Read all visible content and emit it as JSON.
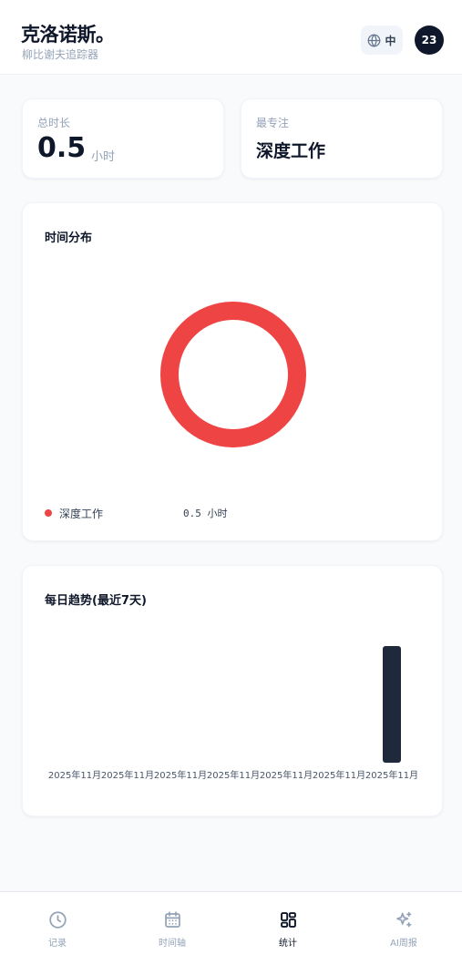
{
  "header": {
    "title": "克洛诺斯。",
    "subtitle": "柳比谢夫追踪器",
    "lang_label": "中",
    "avatar_text": "23"
  },
  "stats": {
    "total_label": "总时长",
    "total_value": "0.5",
    "total_unit": "小时",
    "focus_label": "最专注",
    "focus_value": "深度工作"
  },
  "distribution": {
    "title": "时间分布",
    "legend": [
      {
        "name": "深度工作",
        "value": "0.5 小时",
        "color": "#ef4444"
      }
    ]
  },
  "trend": {
    "title": "每日趋势(最近7天)"
  },
  "nav": {
    "items": [
      {
        "label": "记录",
        "icon": "clock-icon"
      },
      {
        "label": "时间轴",
        "icon": "calendar-icon"
      },
      {
        "label": "统计",
        "icon": "grid-icon"
      },
      {
        "label": "AI周报",
        "icon": "sparkles-icon"
      }
    ],
    "active_index": 2
  },
  "chart_data": [
    {
      "type": "pie",
      "title": "时间分布",
      "labels": [
        "深度工作"
      ],
      "values": [
        0.5
      ],
      "colors": [
        "#ef4444"
      ],
      "unit": "小时",
      "donut": true
    },
    {
      "type": "bar",
      "title": "每日趋势(最近7天)",
      "categories": [
        "2025年11月",
        "2025年11月",
        "2025年11月",
        "2025年11月",
        "2025年11月",
        "2025年11月",
        "2025年11月"
      ],
      "values": [
        0,
        0,
        0,
        0,
        0,
        0,
        0.5
      ],
      "ylim": [
        0,
        0.5
      ],
      "bar_color": "#1e293b",
      "grid": false
    }
  ]
}
